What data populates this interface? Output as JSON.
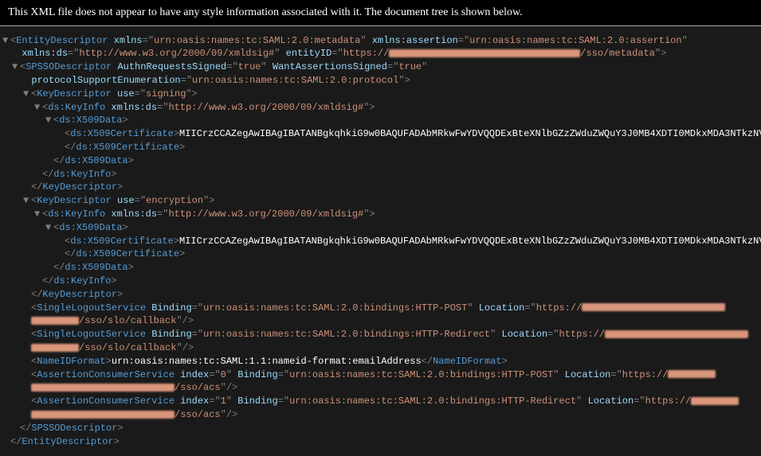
{
  "header": "This XML file does not appear to have any style information associated with it. The document tree is shown below.",
  "toggle": "▼",
  "lt": "<",
  "gt": ">",
  "ltc": "</",
  "sgt": "/>",
  "eq": "=",
  "q": "\"",
  "tags": {
    "entityDescriptor": "EntityDescriptor",
    "spsso": "SPSSODescriptor",
    "keyDescriptor": "KeyDescriptor",
    "keyInfo": "ds:KeyInfo",
    "x509Data": "ds:X509Data",
    "x509Cert": "ds:X509Certificate",
    "slo": "SingleLogoutService",
    "nameId": "NameIDFormat",
    "acs": "AssertionConsumerService"
  },
  "attrs": {
    "xmlns": "xmlns",
    "xmlnsAssertion": "xmlns:assertion",
    "xmlnsDs": "xmlns:ds",
    "entityID": "entityID",
    "authnReq": "AuthnRequestsSigned",
    "wantAssert": "WantAssertionsSigned",
    "protoEnum": "protocolSupportEnumeration",
    "use": "use",
    "binding": "Binding",
    "location": "Location",
    "index": "index"
  },
  "vals": {
    "samlMeta": "urn:oasis:names:tc:SAML:2.0:metadata",
    "samlAssert": "urn:oasis:names:tc:SAML:2.0:assertion",
    "xmldsig": "http://www.w3.org/2000/09/xmldsig#",
    "httpsPrefix": "https://",
    "ssoMeta": "/sso/metadata",
    "true": "true",
    "samlProto": "urn:oasis:names:tc:SAML:2.0:protocol",
    "signing": "signing",
    "encryption": "encryption",
    "cert": "MIICrzCCAZegAwIBAgIBATANBgkqhkiG9w0BAQUFADAbMRkwFwYDVQQDExBteXNlbGZzZWduZWQuY3J0MB4XDTI0MDkxMDA3NTkzNV",
    "httpPost": "urn:oasis:names:tc:SAML:2.0:bindings:HTTP-POST",
    "httpRedirect": "urn:oasis:names:tc:SAML:2.0:bindings:HTTP-Redirect",
    "sloCallback": "/sso/slo/callback",
    "ssoAcs": "/sso/acs",
    "nameIdFormat": "urn:oasis:names:tc:SAML:1.1:nameid-format:emailAddress",
    "idx0": "0",
    "idx1": "1"
  }
}
